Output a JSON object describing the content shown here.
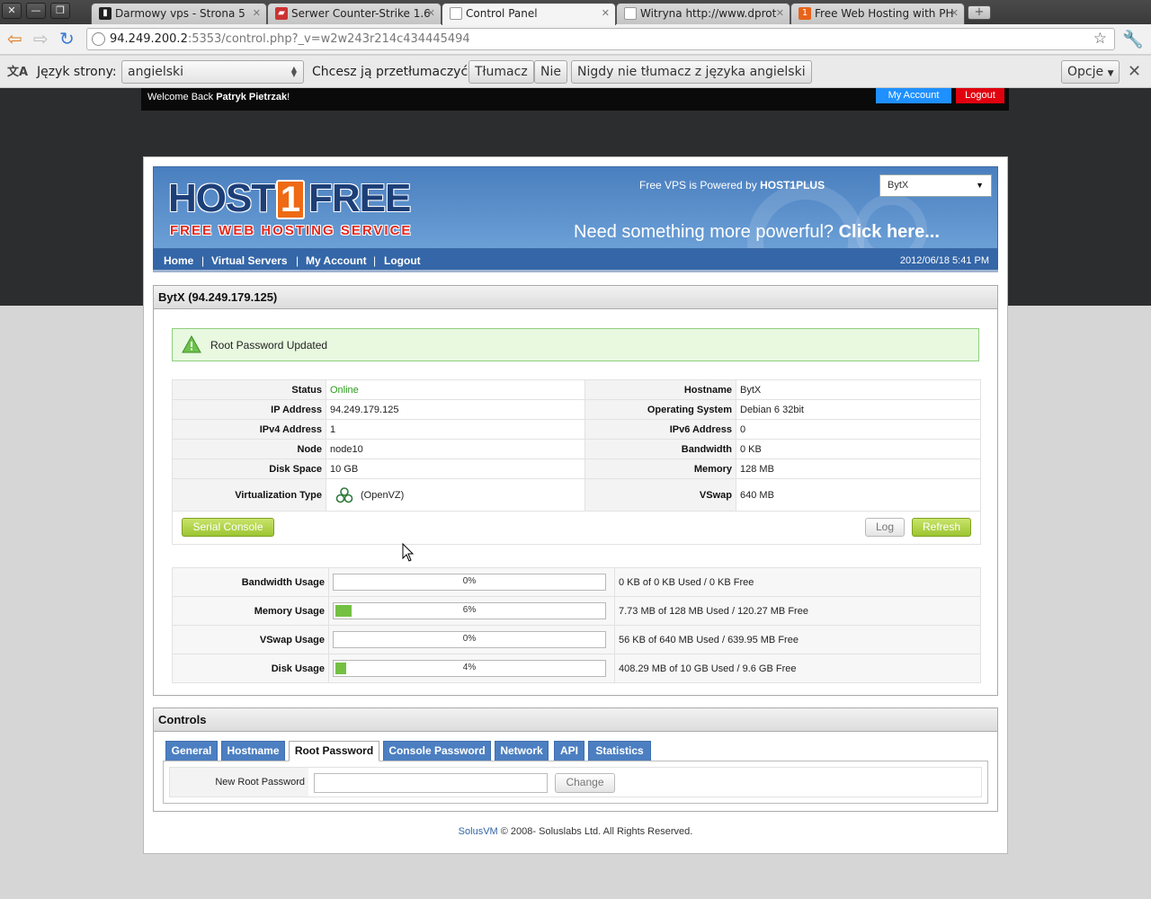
{
  "browser": {
    "tabs": [
      {
        "title": "Darmowy vps - Strona 5",
        "favicon": "terminal-icon",
        "color": "#222"
      },
      {
        "title": "Serwer Counter-Strike 1.6",
        "favicon": "cs-icon",
        "color": "#c33"
      },
      {
        "title": "Control Panel",
        "favicon": "page-icon",
        "color": "#fff"
      },
      {
        "title": "Witryna http://www.dprot",
        "favicon": "page-icon",
        "color": "#fff"
      },
      {
        "title": "Free Web Hosting with PH",
        "favicon": "host1free-icon",
        "color": "#e8631a"
      }
    ],
    "url_host": "94.249.200.2",
    "url_rest": ":5353/control.php?_v=w2w243r214c434445494"
  },
  "translate": {
    "lang_label": "Język strony:",
    "lang_value": "angielski",
    "question": "Chcesz ją przetłumaczyć?",
    "translate_btn": "Tłumacz",
    "no_btn": "Nie",
    "never_btn": "Nigdy nie tłumacz z języka angielski",
    "options_btn": "Opcje"
  },
  "topbar": {
    "welcome": "Welcome Back",
    "user": "Patryk Pietrzak",
    "exclaim": "!",
    "my_account": "My Account",
    "logout": "Logout"
  },
  "banner": {
    "logo_host": "HOST",
    "logo_one": "1",
    "logo_free": "FREE",
    "logo_tagline": "FREE WEB HOSTING SERVICE",
    "powered_prefix": "Free VPS is Powered by",
    "powered_brand": "HOST1PLUS",
    "promo": "Need something more powerful?",
    "promo_link": "Click here...",
    "vps_select": "BytX"
  },
  "nav": {
    "items": [
      "Home",
      "Virtual Servers",
      "My Account",
      "Logout"
    ],
    "date": "2012/06/18 5:41 PM"
  },
  "server": {
    "title": "BytX (94.249.179.125)",
    "alert": "Root Password Updated",
    "info": [
      {
        "k1": "Status",
        "v1": "Online",
        "k2": "Hostname",
        "v2": "BytX"
      },
      {
        "k1": "IP Address",
        "v1": "94.249.179.125",
        "k2": "Operating System",
        "v2": "Debian 6 32bit"
      },
      {
        "k1": "IPv4 Address",
        "v1": "1",
        "k2": "IPv6 Address",
        "v2": "0"
      },
      {
        "k1": "Node",
        "v1": "node10",
        "k2": "Bandwidth",
        "v2": "0 KB"
      },
      {
        "k1": "Disk Space",
        "v1": "10 GB",
        "k2": "Memory",
        "v2": "128 MB"
      },
      {
        "k1": "Virtualization Type",
        "v1": "(OpenVZ)",
        "k2": "VSwap",
        "v2": "640 MB"
      }
    ],
    "status_color": "#2a9a1a",
    "serial_console": "Serial Console",
    "log": "Log",
    "refresh": "Refresh",
    "usage": [
      {
        "label": "Bandwidth Usage",
        "pct_text": "0%",
        "fraction": 0,
        "detail": "0 KB of 0 KB Used / 0 KB Free"
      },
      {
        "label": "Memory Usage",
        "pct_text": "6%",
        "fraction": 0.06,
        "detail": "7.73 MB of 128 MB Used / 120.27 MB Free"
      },
      {
        "label": "VSwap Usage",
        "pct_text": "0%",
        "fraction": 0,
        "detail": "56 KB of 640 MB Used / 639.95 MB Free"
      },
      {
        "label": "Disk Usage",
        "pct_text": "4%",
        "fraction": 0.04,
        "detail": "408.29 MB of 10 GB Used / 9.6 GB Free"
      }
    ]
  },
  "controls": {
    "title": "Controls",
    "tabs": [
      "General",
      "Hostname",
      "Root Password",
      "Console Password",
      "Network",
      "API",
      "Statistics"
    ],
    "active_tab": "Root Password",
    "field_label": "New Root Password",
    "field_value": "",
    "change_btn": "Change"
  },
  "footer": {
    "link": "SolusVM",
    "text": " © 2008- Soluslabs Ltd. All Rights Reserved."
  }
}
